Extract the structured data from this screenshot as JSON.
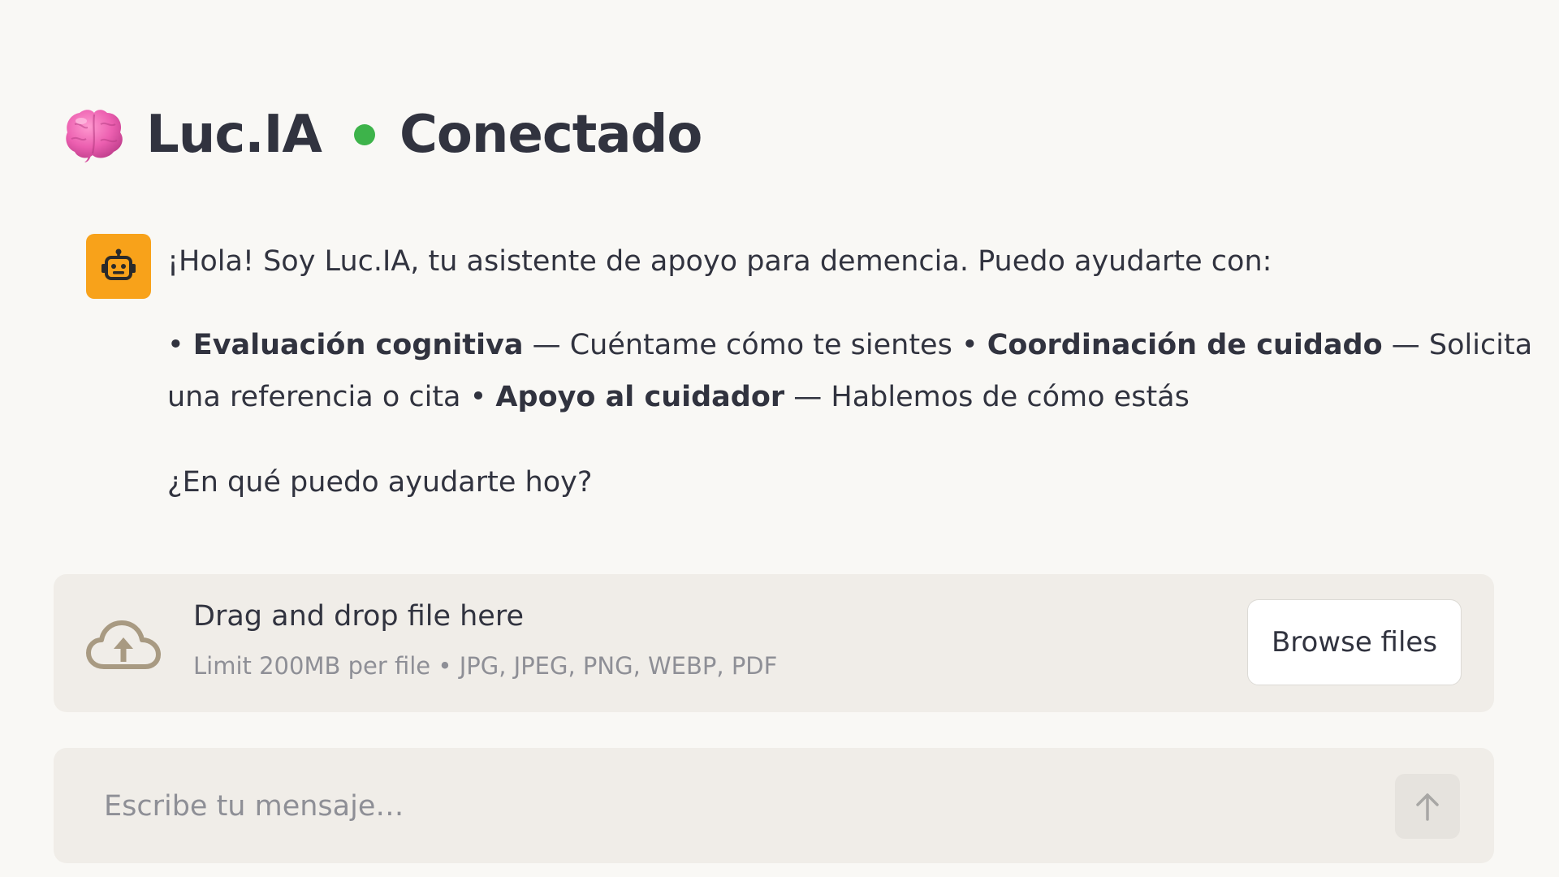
{
  "header": {
    "logo_icon": "brain-icon",
    "title": "Luc.IA",
    "status_color": "#3db34a",
    "status": "Conectado"
  },
  "message": {
    "avatar_icon": "robot-icon",
    "avatar_color": "#f8a21a",
    "intro": "¡Hola! Soy Luc.IA, tu asistente de apoyo para demencia. Puedo ayudarte con:",
    "items": [
      {
        "bullet": "• ",
        "bold": "Evaluación cognitiva",
        "rest": " — Cuéntame cómo te sientes "
      },
      {
        "bullet": "• ",
        "bold": "Coordinación de cuidado",
        "rest": " — Solicita una referencia o cita "
      },
      {
        "bullet": "• ",
        "bold": "Apoyo al cuidador",
        "rest": " — Hablemos de cómo estás"
      }
    ],
    "question": "¿En qué puedo ayudarte hoy?"
  },
  "uploader": {
    "icon": "cloud-upload-icon",
    "title": "Drag and drop file here",
    "limit": "Limit 200MB per file • JPG, JPEG, PNG, WEBP, PDF",
    "browse_label": "Browse files"
  },
  "chat": {
    "placeholder": "Escribe tu mensaje…",
    "value": "",
    "send_icon": "arrow-up-icon"
  }
}
